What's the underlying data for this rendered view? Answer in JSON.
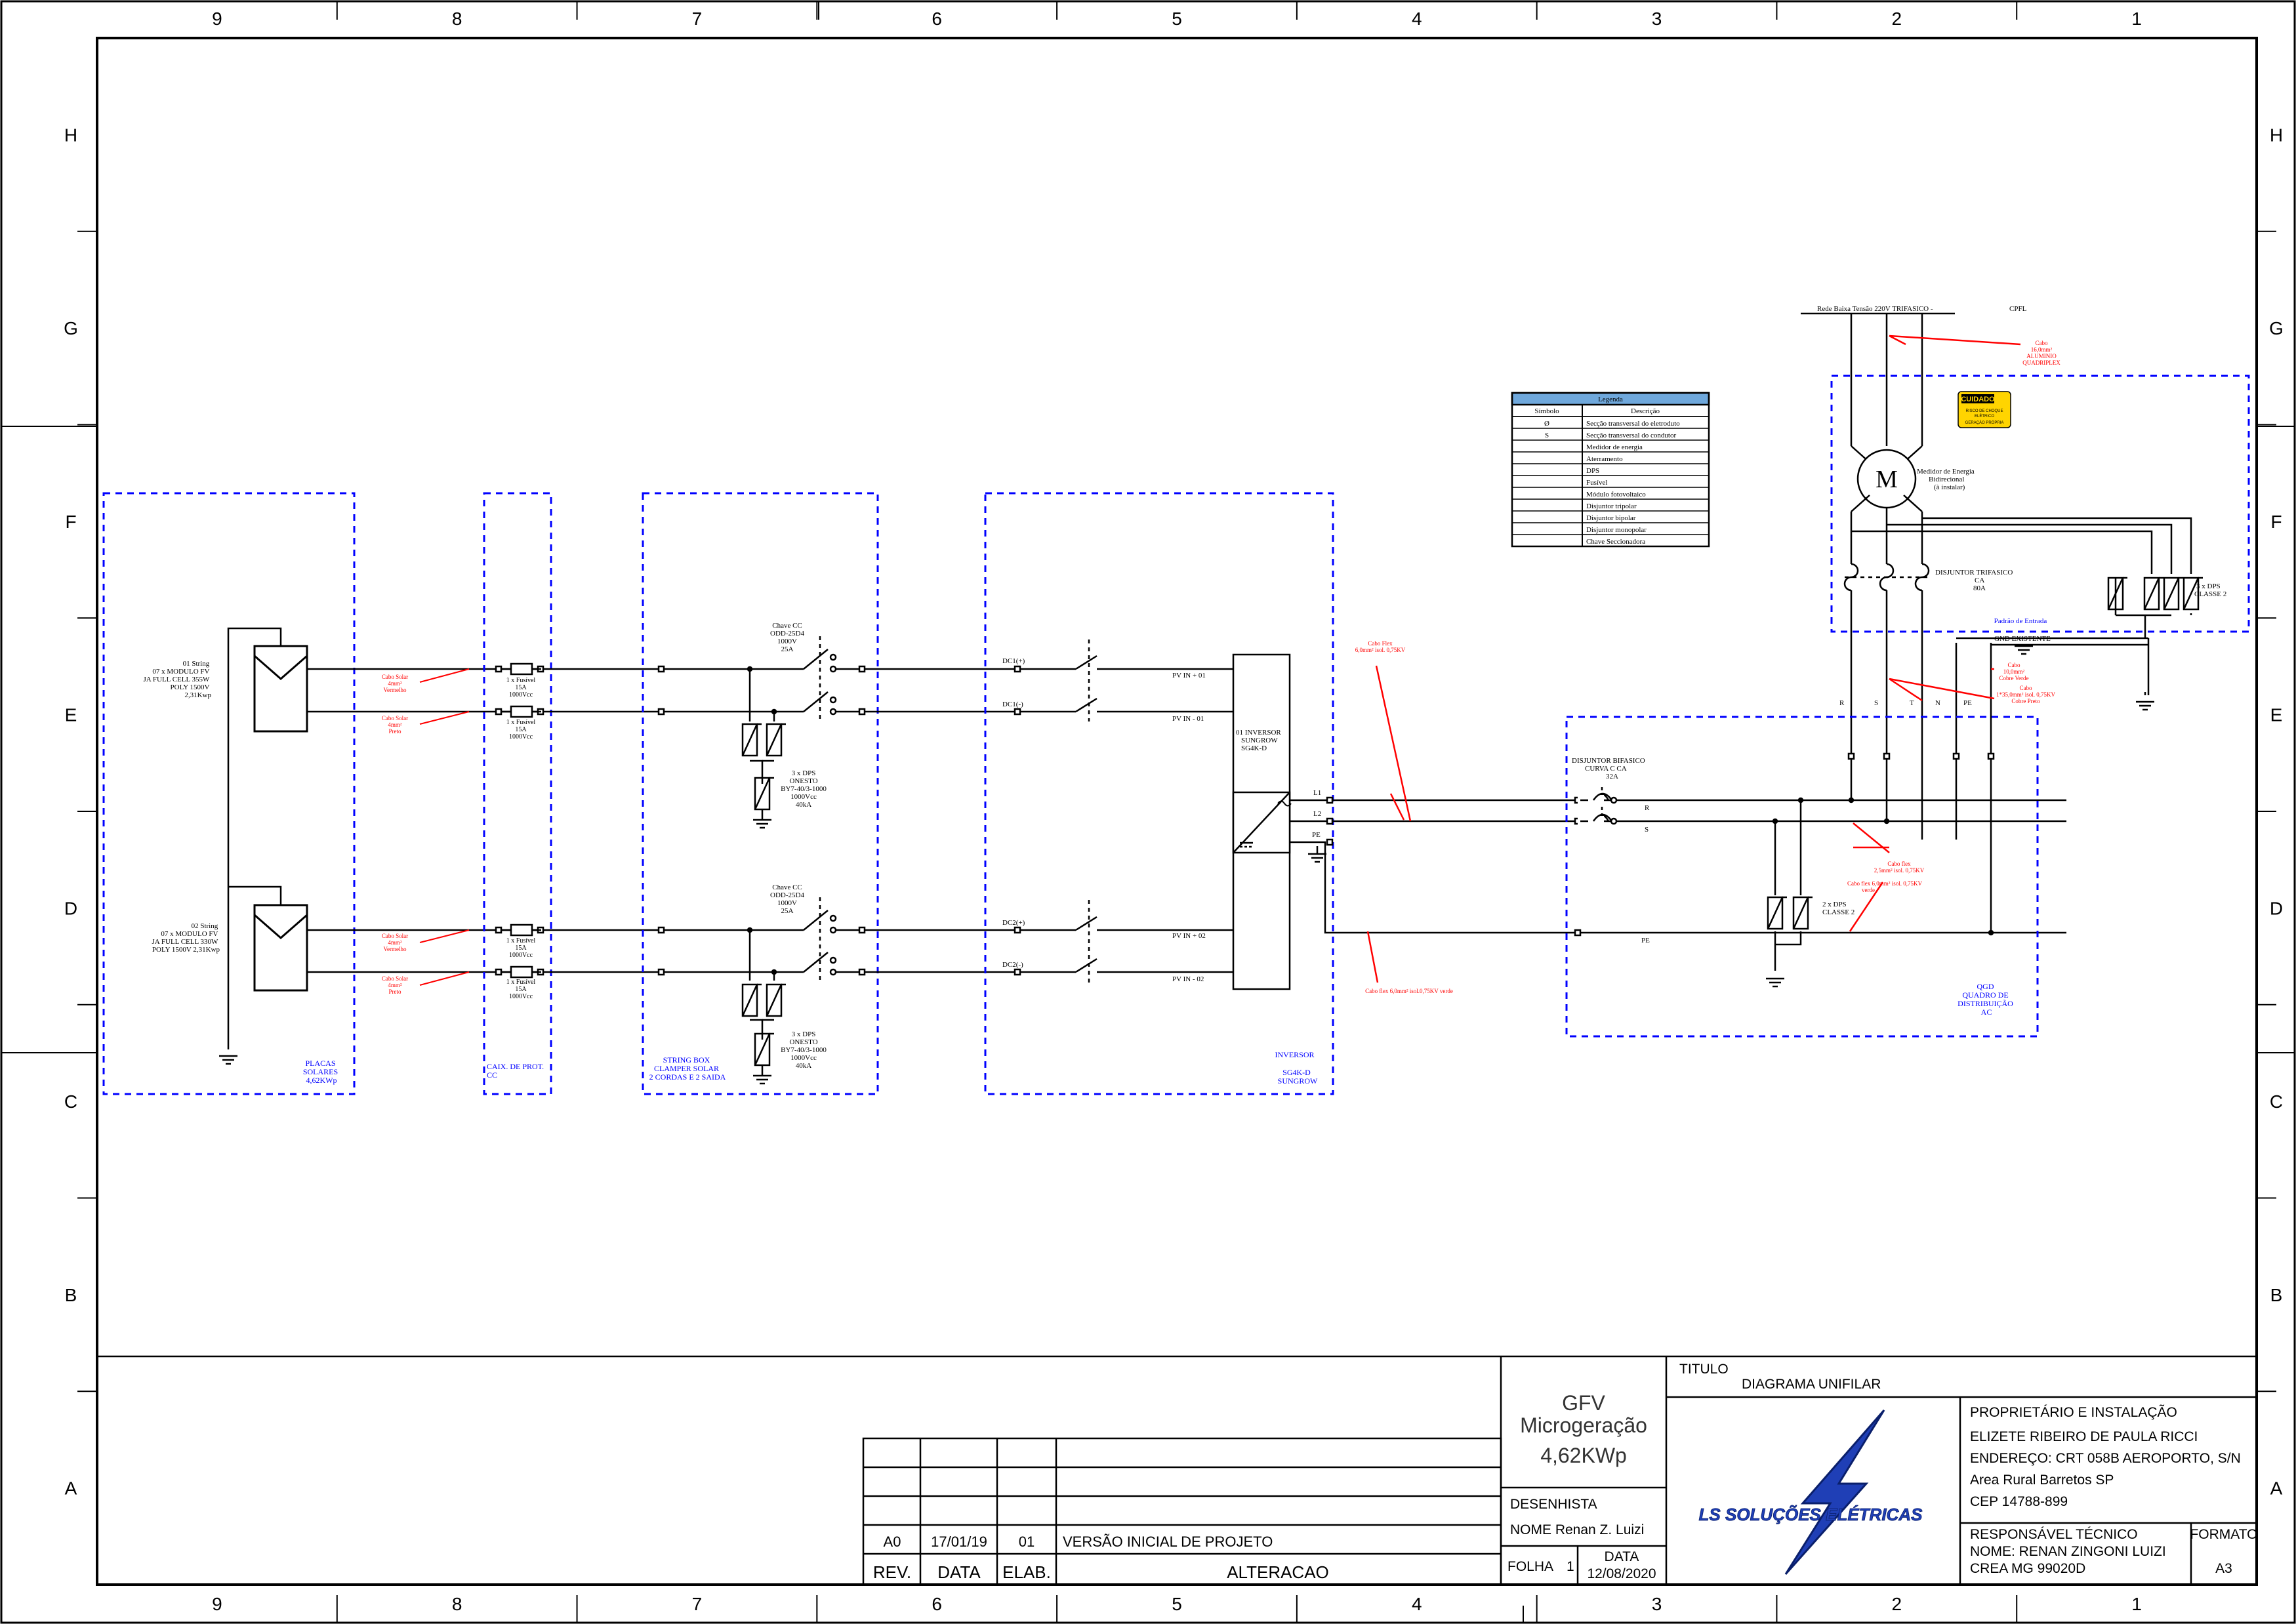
{
  "border": {
    "columns": [
      "9",
      "8",
      "7",
      "6",
      "5",
      "4",
      "3",
      "2",
      "1"
    ],
    "rows": [
      "H",
      "G",
      "F",
      "E",
      "D",
      "C",
      "B",
      "A"
    ]
  },
  "colors": {
    "line": "#000000",
    "boundary": "#0000ff",
    "cable_note": "#ff0000",
    "legend_header": "#6fa8dc",
    "caution": "#ffd400"
  },
  "pv": {
    "string1": [
      "01 String",
      "07 x MODULO FV",
      "JA FULL CELL 355W",
      "POLY 1500V",
      "2,31Kwp"
    ],
    "string2": [
      "02 String",
      "07 x MODULO FV",
      "JA FULL CELL 330W",
      "POLY 1500V 2,31Kwp"
    ],
    "panel_label": [
      "PLACAS",
      "SOLARES",
      "4,62KWp"
    ]
  },
  "cable_notes": {
    "pv_red": [
      "Cabo Solar",
      "4mm²",
      "Vermelho"
    ],
    "pv_black": [
      "Cabo Solar",
      "4mm²",
      "Preto"
    ],
    "inv_black": [
      "Cabo Flex",
      "6,0mm² isol. 0,75KV"
    ],
    "inv_green": "Cabo flex 6,0mm² isol.0,75KV verde",
    "grid_in": [
      "Cabo",
      "16,0mm²",
      "ALUMINIO",
      "QUADRIPLEX"
    ],
    "gnd": [
      "Cabo",
      "10,0mm²",
      "Cobre Verde"
    ],
    "gnd2": [
      "Cabo",
      "1*35,0mm² isol. 0,75KV",
      "Cobre Preto"
    ],
    "qgd_black": [
      "Cabo flex",
      "2,5mm² isol. 0,75KV"
    ],
    "qgd_green": [
      "Cabo flex 6,0mm² isol. 0,75KV",
      "verde"
    ]
  },
  "protection_box": {
    "fuse_label": [
      "1 x Fusível",
      "15A",
      "1000Vcc"
    ],
    "label": [
      "CAIX. DE PROT.",
      "CC"
    ]
  },
  "string_box": {
    "switch_label": [
      "Chave CC",
      "ODD-25D4",
      "1000V",
      "25A"
    ],
    "dps_label": [
      "3 x DPS",
      "ONESTO",
      "BY7-40/3-1000",
      "1000Vcc",
      "40kA"
    ],
    "label": [
      "STRING BOX",
      "CLAMPER SOLAR",
      "2 CORDAS E 2 SAIDA"
    ]
  },
  "inverter": {
    "inputs": [
      "DC1(+)",
      "DC1(-)",
      "DC2(+)",
      "DC2(-)"
    ],
    "pv_in": [
      "PV IN + 01",
      "PV IN - 01",
      "PV IN + 02",
      "PV IN - 02"
    ],
    "name": [
      "01 INVERSOR",
      "SUNGROW",
      "SG4K-D"
    ],
    "outputs": [
      "L1",
      "L2",
      "PE"
    ],
    "label": [
      "INVERSOR",
      "SG4K-D",
      "SUNGROW"
    ]
  },
  "legend": {
    "title": "Legenda",
    "col_symbol": "Símbolo",
    "col_desc": "Descrição",
    "items": [
      {
        "symbol": "Ø",
        "desc": "Secção transversal do eletroduto"
      },
      {
        "symbol": "S",
        "desc": "Secção transversal do condutor"
      },
      {
        "symbol": "",
        "desc": "Medidor de energia"
      },
      {
        "symbol": "",
        "desc": "Aterramento"
      },
      {
        "symbol": "",
        "desc": "DPS"
      },
      {
        "symbol": "",
        "desc": "Fusível"
      },
      {
        "symbol": "",
        "desc": "Módulo fotovoltaico"
      },
      {
        "symbol": "",
        "desc": "Disjuntor tripolar"
      },
      {
        "symbol": "",
        "desc": "Disjuntor bipolar"
      },
      {
        "symbol": "",
        "desc": "Disjuntor monopolar"
      },
      {
        "symbol": "",
        "desc": "Chave Seccionadora"
      }
    ]
  },
  "grid": {
    "title": "Rede Baixa Tensão 220V TRIFASICO -",
    "utility": "CPFL",
    "caution": [
      "CUIDADO",
      "RISCO DE CHOQUE",
      "ELÉTRICO",
      "GERAÇÃO PRÓPRIA"
    ],
    "meter_symbol": "M",
    "meter_label": [
      "Medidor de Energia",
      "Bidirecional",
      "(à instalar)"
    ],
    "breaker_label": [
      "DISJUNTOR TRIFASICO",
      "CA",
      "80A"
    ],
    "dps_label": [
      "3 x DPS",
      "CLASSE 2"
    ],
    "entry_label": "Padrão de Entrada",
    "gnd_label": "GND EXISTENTE",
    "phases": [
      "R",
      "S",
      "T",
      "N",
      "PE"
    ]
  },
  "qgd": {
    "breaker_label": [
      "DISJUNTOR BIFASICO",
      "CURVA C CA",
      "32A"
    ],
    "phase_r": "R",
    "phase_s": "S",
    "pe": "PE",
    "dps_label": [
      "2 x DPS",
      "CLASSE 2"
    ],
    "label": [
      "QGD",
      "QUADRO DE",
      "DISTRIBUIÇÃO",
      "AC"
    ]
  },
  "title_block": {
    "rev_header": [
      "REV.",
      "DATA",
      "ELAB.",
      "ALTERACAO"
    ],
    "rev_row": [
      "A0",
      "17/01/19",
      "01",
      "VERSÃO INICIAL DE PROJETO"
    ],
    "project": [
      "GFV",
      "Microgeração",
      "4,62KWp"
    ],
    "drawer_label": "DESENHISTA",
    "drawer_name": "NOME Renan Z. Luizi",
    "sheet_label": "FOLHA",
    "sheet_no": "1",
    "date_label": "DATA",
    "date": "12/08/2020",
    "title_label": "TITULO",
    "title": "DIAGRAMA UNIFILAR",
    "logo_text": "LS SOLUÇÕES ELÉTRICAS",
    "owner_label": "PROPRIETÁRIO E INSTALAÇÃO",
    "owner": [
      "ELIZETE RIBEIRO DE PAULA RICCI",
      "ENDEREÇO: CRT 058B AEROPORTO, S/N",
      "Area Rural Barretos SP",
      "CEP 14788-899"
    ],
    "rt_label": "RESPONSÁVEL TÉCNICO",
    "rt": [
      "NOME: RENAN ZINGONI LUIZI",
      "CREA    MG 99020D"
    ],
    "format_label": "FORMATO",
    "format": "A3"
  }
}
